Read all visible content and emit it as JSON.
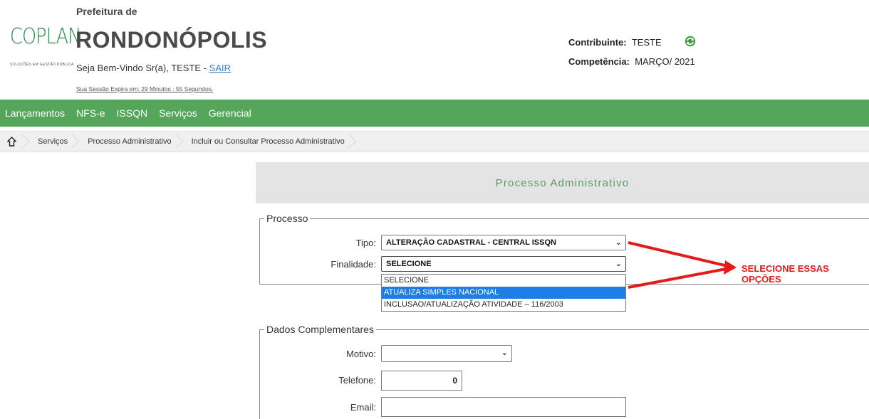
{
  "header": {
    "logo_text": "COPLAN",
    "logo_tagline": "SOLUÇÕES EM GESTÃO PÚBLICA",
    "prefeitura_label": "Prefeitura de",
    "city": "RONDONÓPOLIS",
    "welcome_text": "Seja Bem-Vindo Sr(a), TESTE -",
    "sair_link": "SAIR",
    "session_text": "Sua Sessão Expira em: 29 Minutos : 55 Segundos.",
    "contribuinte_label": "Contribuinte:",
    "contribuinte_value": "TESTE",
    "competencia_label": "Competência:",
    "competencia_value": "MARÇO/ 2021"
  },
  "nav": {
    "items": [
      "Lançamentos",
      "NFS-e",
      "ISSQN",
      "Serviços",
      "Gerencial"
    ]
  },
  "breadcrumb": {
    "items": [
      "Serviços",
      "Processo Administrativo",
      "Incluir ou Consultar Processo Administrativo"
    ]
  },
  "page": {
    "title": "Processo Administrativo"
  },
  "processo": {
    "legend": "Processo",
    "tipo_label": "Tipo:",
    "tipo_value": "ALTERAÇÃO CADASTRAL - CENTRAL ISSQN",
    "finalidade_label": "Finalidade:",
    "finalidade_value": "SELECIONE",
    "finalidade_options": [
      "SELECIONE",
      "ATUALIZA SIMPLES NACIONAL",
      "INCLUSAO/ATUALIZAÇÃO ATIVIDADE – 116/2003"
    ],
    "finalidade_highlighted": "ATUALIZA SIMPLES NACIONAL"
  },
  "dados": {
    "legend": "Dados Complementares",
    "motivo_label": "Motivo:",
    "motivo_value": "",
    "telefone_label": "Telefone:",
    "telefone_value": "0",
    "email_label": "Email:",
    "email_value": ""
  },
  "annotation": {
    "text": "SELECIONE ESSAS OPÇÕES",
    "color": "#e21b1b"
  },
  "colors": {
    "nav_green": "#55a55b",
    "title_green": "#5a9a60",
    "highlight_blue": "#1e7ee6",
    "link_blue": "#3b7fc4"
  },
  "icons": {
    "home": "home-icon",
    "refresh": "refresh-icon",
    "chevron": "chevron-down-icon"
  }
}
